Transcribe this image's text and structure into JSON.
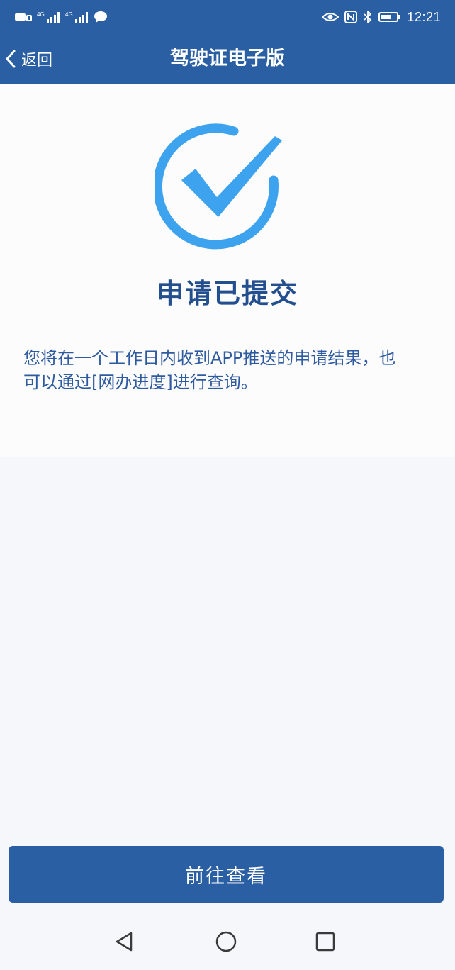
{
  "status_bar": {
    "time": "12:21",
    "icons": [
      "sim-icon",
      "signal-icon",
      "signal-icon",
      "message-icon",
      "eye-icon",
      "nfc-icon",
      "bluetooth-icon",
      "battery-icon"
    ]
  },
  "nav": {
    "back_label": "返回",
    "title": "驾驶证电子版"
  },
  "result": {
    "icon": "check-circle-icon",
    "title": "申请已提交",
    "description": "您将在一个工作日内收到APP推送的申请结果，也可以通过[网办进度]进行查询。"
  },
  "action": {
    "button_label": "前往查看"
  },
  "system_nav": {
    "icons": [
      "back-triangle-icon",
      "home-circle-icon",
      "recents-square-icon"
    ]
  },
  "colors": {
    "header": "#2b5fa3",
    "accent": "#3ea3ee",
    "title_text": "#244f8e",
    "body_text": "#2e5aa0",
    "background": "#f6f7fa"
  }
}
